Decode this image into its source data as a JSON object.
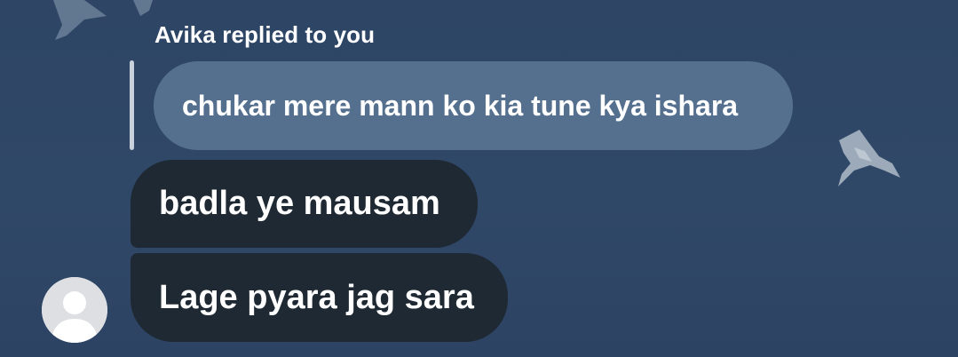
{
  "chat": {
    "reply_header": "Avika replied to you",
    "quoted_message": "chukar mere mann ko kia tune kya ishara",
    "messages": [
      {
        "text": "badla ye mausam"
      },
      {
        "text": "Lage pyara jag sara"
      }
    ],
    "avatar_icon": "default-user-avatar-icon"
  },
  "colors": {
    "background": "#2e4565",
    "quoted_bubble": "#55708f",
    "message_bubble": "#1f2933",
    "reply_bar": "#c9d2dc",
    "avatar_bg": "#dddfe3"
  }
}
